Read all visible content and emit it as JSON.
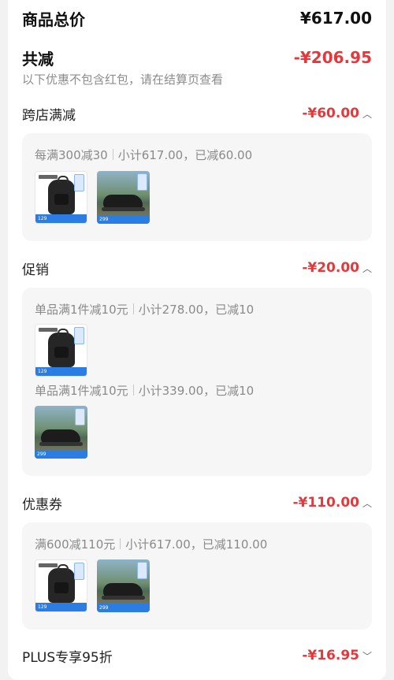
{
  "summary": {
    "total_label": "商品总价",
    "total_value": "¥617.00",
    "discount_label": "共减",
    "discount_value": "-¥206.95",
    "note": "以下优惠不包含红包，请在结算页查看"
  },
  "sections": [
    {
      "title": "跨店满减",
      "amount": "-¥60.00",
      "chevron": "chevron-up-icon",
      "groups": [
        {
          "rule": "每满300减30",
          "detail": "小计617.00，已减60.00",
          "items": [
            {
              "kind": "backpack",
              "price": "129"
            },
            {
              "kind": "shoe",
              "price": "299"
            }
          ]
        }
      ]
    },
    {
      "title": "促销",
      "amount": "-¥20.00",
      "chevron": "chevron-up-icon",
      "groups": [
        {
          "rule": "单品满1件减10元",
          "detail": "小计278.00，已减10",
          "items": [
            {
              "kind": "backpack",
              "price": "129"
            }
          ]
        },
        {
          "rule": "单品满1件减10元",
          "detail": "小计339.00，已减10",
          "items": [
            {
              "kind": "shoe",
              "price": "299"
            }
          ]
        }
      ]
    },
    {
      "title": "优惠券",
      "amount": "-¥110.00",
      "chevron": "chevron-up-icon",
      "groups": [
        {
          "rule": "满600减110元",
          "detail": "小计617.00，已减110.00",
          "items": [
            {
              "kind": "backpack",
              "price": "129"
            },
            {
              "kind": "shoe",
              "price": "299"
            }
          ]
        }
      ]
    },
    {
      "title": "PLUS专享95折",
      "amount": "-¥16.95",
      "chevron": "chevron-down-icon",
      "groups": []
    }
  ],
  "colors": {
    "accent": "#e4393c",
    "muted": "#8c8c8c",
    "card": "#f6f6f6"
  }
}
